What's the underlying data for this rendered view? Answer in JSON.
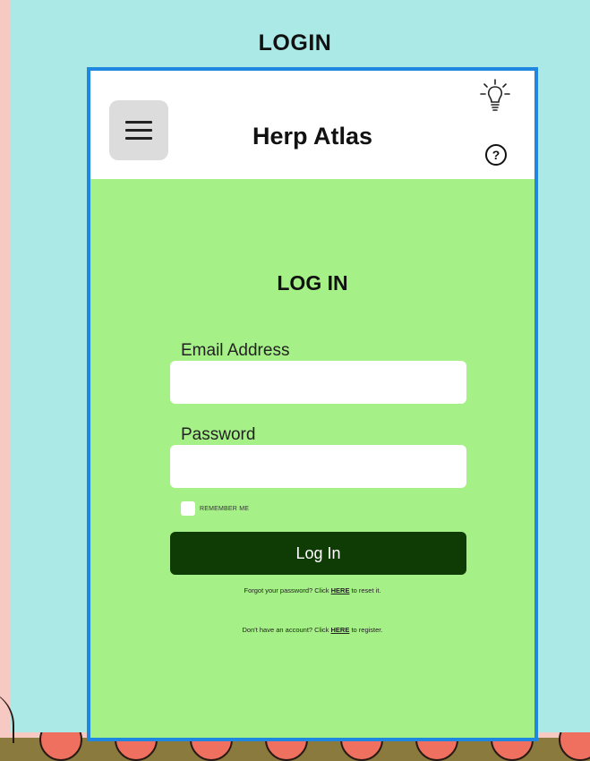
{
  "page_label": "LOGIN",
  "app": {
    "title": "Herp Atlas",
    "menu_icon": "hamburger-menu-icon",
    "tip_icon": "lightbulb-icon",
    "help_icon": "question-mark-icon"
  },
  "form": {
    "title": "LOG IN",
    "email_label": "Email Address",
    "email_value": "",
    "password_label": "Password",
    "password_value": "",
    "remember_label": "REMEMBER ME",
    "remember_checked": false,
    "submit_label": "Log In",
    "forgot_prefix": "Forgot your password? Click ",
    "forgot_link": "HERE",
    "forgot_suffix": " to reset it.",
    "register_prefix": "Don't have an account? Click ",
    "register_link": "HERE",
    "register_suffix": " to register."
  },
  "colors": {
    "background": "#abe9e6",
    "frame_border": "#1f87e0",
    "form_background": "#a6f187",
    "button": "#0f3b05"
  }
}
